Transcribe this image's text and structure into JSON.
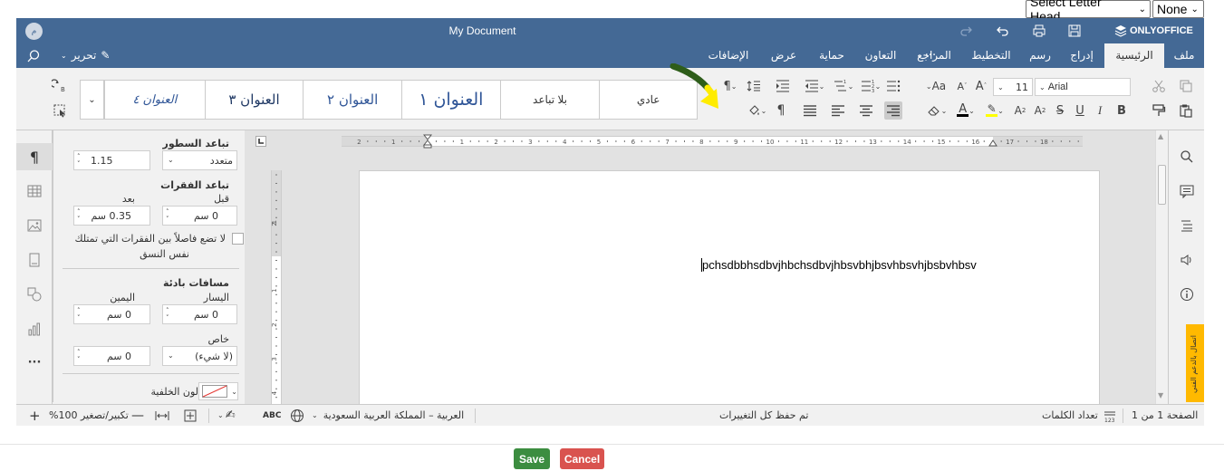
{
  "page_controls": {
    "letter_head_select": "Select Letter Head",
    "none_select": "None"
  },
  "title_bar": {
    "doc_title": "My Document",
    "brand": "ONLYOFFICE",
    "avatar_initial": "م"
  },
  "tabs": {
    "file": "ملف",
    "home": "الرئيسية",
    "insert": "إدراج",
    "draw": "رسم",
    "layout": "التخطيط",
    "references": "المراجع",
    "collaboration": "التعاون",
    "protection": "حماية",
    "view": "عرض",
    "plugins": "الإضافات",
    "more": "···",
    "edit_mode": "تحرير"
  },
  "toolbar": {
    "font_name": "Arial",
    "font_size": "11",
    "styles": [
      "عادي",
      "بلا تباعد",
      "العنوان ١",
      "العنوان ٢",
      "العنوان ٣",
      "العنوان ٤"
    ]
  },
  "settings": {
    "line_spacing_title": "تباعد السطور",
    "line_spacing_mode": "متعدد",
    "line_spacing_value": "1.15",
    "para_spacing_title": "تباعد الفقرات",
    "before_label": "قبل",
    "after_label": "بعد",
    "before_value": "0 سم",
    "after_value": "0.35 سم",
    "no_space_same_style_line1": "لا تضع فاصلاً بين الفقرات التي تمتلك",
    "no_space_same_style_line2": "نفس النسق",
    "indents_title": "مسافات بادئة",
    "left_label": "اليسار",
    "right_label": "اليمين",
    "left_value": "0 سم",
    "right_value": "0 سم",
    "special_label": "خاص",
    "special_mode": "(لا شيء)",
    "special_value": "0 سم",
    "background_color_label": "لون الخلفية"
  },
  "ruler": {
    "ticks": [
      "2",
      "1",
      "1",
      "2",
      "3",
      "4",
      "5",
      "6",
      "7",
      "8",
      "9",
      "10",
      "11",
      "12",
      "13",
      "14",
      "15",
      "16",
      "17",
      "18"
    ],
    "v_ticks": [
      "2",
      "1",
      "1",
      "2",
      "3",
      "4"
    ]
  },
  "document": {
    "body_text": "pchsdbbhsdbvjhbchsdbvjhbsvbhjbsvhbsvhjbsbvhbsv"
  },
  "side_tab": {
    "label": "اتصال بالدعم الفني"
  },
  "status_bar": {
    "page_info": "الصفحة 1 من 1",
    "word_count": "تعداد الكلمات",
    "save_state": "تم حفظ كل التغييرات",
    "language": "العربية – المملكة العربية السعودية",
    "zoom": "تكبير/تصغير 100%"
  },
  "actions": {
    "save": "Save",
    "cancel": "Cancel"
  },
  "colors": {
    "header": "#446995",
    "save_button": "#3c8d40",
    "cancel_button": "#d9534f",
    "highlight_arrow": "#ffec00",
    "arrow_dark": "#2e5d1a",
    "support_tab": "#ffb900"
  }
}
